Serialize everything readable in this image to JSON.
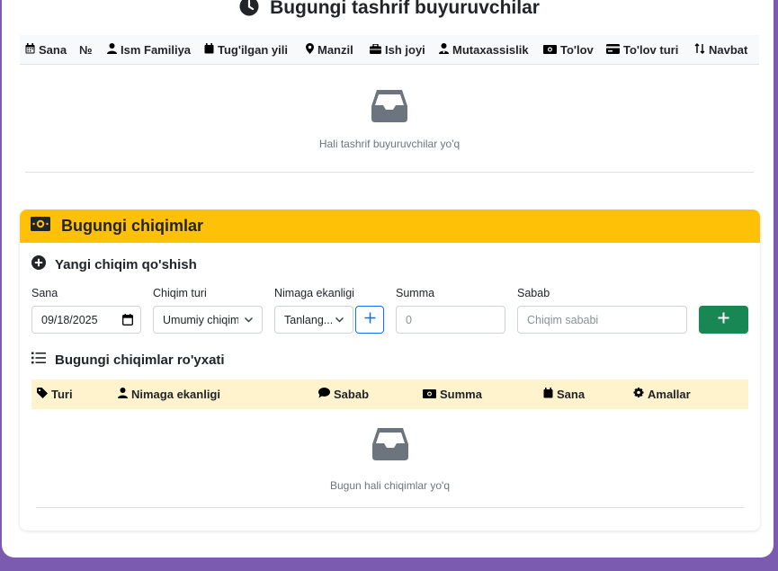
{
  "visitors": {
    "title": "Bugungi tashrif buyuruvchilar",
    "columns": [
      {
        "label": "Sana",
        "icon": "calendar-icon"
      },
      {
        "label": "№",
        "icon": ""
      },
      {
        "label": "Ism Familiya",
        "icon": "user-icon"
      },
      {
        "label": "Tug'ilgan yili",
        "icon": "calendar-icon"
      },
      {
        "label": "Manzil",
        "icon": "map-marker-icon"
      },
      {
        "label": "Ish joyi",
        "icon": "briefcase-icon"
      },
      {
        "label": "Mutaxassislik",
        "icon": "user-doctor-icon"
      },
      {
        "label": "To'lov",
        "icon": "money-bill-icon"
      },
      {
        "label": "To'lov turi",
        "icon": "credit-card-icon"
      },
      {
        "label": "Navbat",
        "icon": "sort-icon"
      }
    ],
    "empty_text": "Hali tashrif buyuruvchilar yo'q"
  },
  "expenses": {
    "title": "Bugungi chiqimlar",
    "add_title": "Yangi chiqim qo'shish",
    "form": {
      "date_label": "Sana",
      "date_value": "09/18/2025",
      "type_label": "Chiqim turi",
      "type_value": "Umumiy chiqim",
      "purpose_label": "Nimaga ekanligi",
      "purpose_value": "Tanlang...",
      "amount_label": "Summa",
      "amount_placeholder": "0",
      "reason_label": "Sabab",
      "reason_placeholder": "Chiqim sababi"
    },
    "list_title": "Bugungi chiqimlar ro'yxati",
    "columns": [
      {
        "label": "Turi",
        "icon": "tag-icon"
      },
      {
        "label": "Nimaga ekanligi",
        "icon": "user-icon"
      },
      {
        "label": "Sabab",
        "icon": "comment-icon"
      },
      {
        "label": "Summa",
        "icon": "money-bill-icon"
      },
      {
        "label": "Sana",
        "icon": "calendar-icon"
      },
      {
        "label": "Amallar",
        "icon": "gear-icon"
      }
    ],
    "empty_text": "Bugun hali chiqimlar yo'q"
  },
  "colors": {
    "background": "#7a5bb0",
    "warning": "#ffc107",
    "warning_light": "#fff3cd",
    "success": "#198754",
    "primary": "#0d6efd",
    "muted_icon": "#6c757d"
  }
}
